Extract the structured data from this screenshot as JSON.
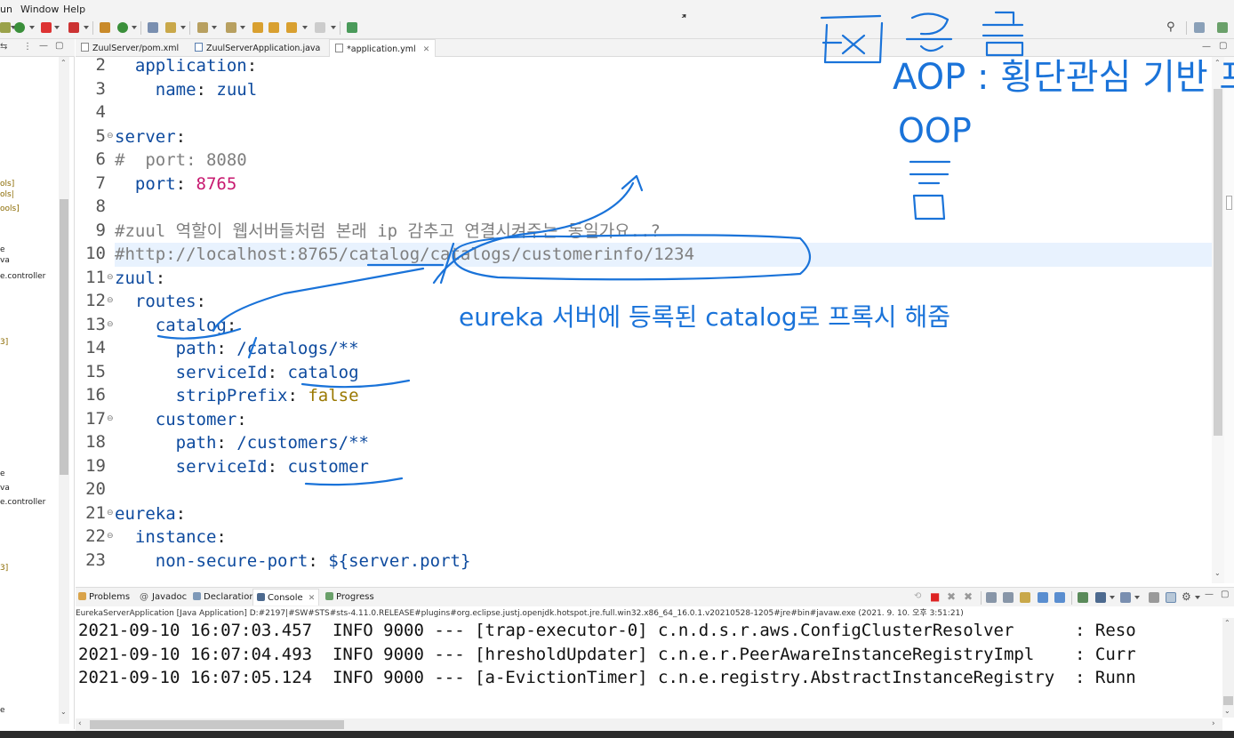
{
  "menu": [
    "un",
    "Window",
    "Help"
  ],
  "left_pane": {
    "fragments": [
      {
        "text": "ols]",
        "style": "brown"
      },
      {
        "text": "ols|",
        "style": "brown"
      },
      {
        "text": "ools]",
        "style": "brown"
      },
      {
        "text": "e",
        "style": ""
      },
      {
        "text": "va",
        "style": ""
      },
      {
        "text": "e.controller",
        "style": ""
      },
      {
        "text": "3]",
        "style": "brown"
      },
      {
        "text": "e",
        "style": ""
      },
      {
        "text": "va",
        "style": ""
      },
      {
        "text": "e.controller",
        "style": ""
      },
      {
        "text": "3]",
        "style": "brown"
      },
      {
        "text": "e",
        "style": ""
      }
    ]
  },
  "editor_tabs": [
    {
      "label": "ZuulServer/pom.xml"
    },
    {
      "label": "ZuulServerApplication.java"
    },
    {
      "label": "*application.yml"
    }
  ],
  "code_lines": [
    {
      "n": "2",
      "fold": false,
      "current": false,
      "tokens": [
        {
          "t": "  application",
          "c": "k"
        },
        {
          "t": ":",
          "c": "p"
        }
      ]
    },
    {
      "n": "3",
      "fold": false,
      "current": false,
      "tokens": [
        {
          "t": "    name",
          "c": "k"
        },
        {
          "t": ": ",
          "c": "p"
        },
        {
          "t": "zuul",
          "c": "v"
        }
      ]
    },
    {
      "n": "4",
      "fold": false,
      "current": false,
      "tokens": []
    },
    {
      "n": "5",
      "fold": true,
      "current": false,
      "tokens": [
        {
          "t": "server",
          "c": "k"
        },
        {
          "t": ":",
          "c": "p"
        }
      ]
    },
    {
      "n": "6",
      "fold": false,
      "current": false,
      "tokens": [
        {
          "t": "#  port: 8080",
          "c": "c"
        }
      ]
    },
    {
      "n": "7",
      "fold": false,
      "current": false,
      "tokens": [
        {
          "t": "  port",
          "c": "k"
        },
        {
          "t": ": ",
          "c": "p"
        },
        {
          "t": "8765",
          "c": "n"
        }
      ]
    },
    {
      "n": "8",
      "fold": false,
      "current": false,
      "tokens": []
    },
    {
      "n": "9",
      "fold": false,
      "current": false,
      "tokens": [
        {
          "t": "#zuul 역할이 웹서버들처럼 본래 ip 감추고 연결시켜주는 동일가요..?",
          "c": "c"
        }
      ]
    },
    {
      "n": "10",
      "fold": false,
      "current": true,
      "tokens": [
        {
          "t": "#http://localhost:8765/catalog/catalogs/customerinfo/1234",
          "c": "c"
        }
      ]
    },
    {
      "n": "11",
      "fold": true,
      "current": false,
      "tokens": [
        {
          "t": "zuul",
          "c": "k"
        },
        {
          "t": ":",
          "c": "p"
        }
      ]
    },
    {
      "n": "12",
      "fold": true,
      "current": false,
      "tokens": [
        {
          "t": "  routes",
          "c": "k"
        },
        {
          "t": ":",
          "c": "p"
        }
      ]
    },
    {
      "n": "13",
      "fold": true,
      "current": false,
      "tokens": [
        {
          "t": "    catalog",
          "c": "k"
        },
        {
          "t": ":",
          "c": "p"
        }
      ]
    },
    {
      "n": "14",
      "fold": false,
      "current": false,
      "tokens": [
        {
          "t": "      path",
          "c": "k"
        },
        {
          "t": ": ",
          "c": "p"
        },
        {
          "t": "/catalogs/**",
          "c": "v"
        }
      ]
    },
    {
      "n": "15",
      "fold": false,
      "current": false,
      "tokens": [
        {
          "t": "      serviceId",
          "c": "k"
        },
        {
          "t": ": ",
          "c": "p"
        },
        {
          "t": "catalog",
          "c": "v"
        }
      ]
    },
    {
      "n": "16",
      "fold": false,
      "current": false,
      "tokens": [
        {
          "t": "      stripPrefix",
          "c": "k"
        },
        {
          "t": ": ",
          "c": "p"
        },
        {
          "t": "false",
          "c": "b"
        }
      ]
    },
    {
      "n": "17",
      "fold": true,
      "current": false,
      "tokens": [
        {
          "t": "    customer",
          "c": "k"
        },
        {
          "t": ":",
          "c": "p"
        }
      ]
    },
    {
      "n": "18",
      "fold": false,
      "current": false,
      "tokens": [
        {
          "t": "      path",
          "c": "k"
        },
        {
          "t": ": ",
          "c": "p"
        },
        {
          "t": "/customers/**",
          "c": "v"
        }
      ]
    },
    {
      "n": "19",
      "fold": false,
      "current": false,
      "tokens": [
        {
          "t": "      serviceId",
          "c": "k"
        },
        {
          "t": ": ",
          "c": "p"
        },
        {
          "t": "customer",
          "c": "v"
        }
      ]
    },
    {
      "n": "20",
      "fold": false,
      "current": false,
      "tokens": []
    },
    {
      "n": "21",
      "fold": true,
      "current": false,
      "tokens": [
        {
          "t": "eureka",
          "c": "k"
        },
        {
          "t": ":",
          "c": "p"
        }
      ]
    },
    {
      "n": "22",
      "fold": true,
      "current": false,
      "tokens": [
        {
          "t": "  instance",
          "c": "k"
        },
        {
          "t": ":",
          "c": "p"
        }
      ]
    },
    {
      "n": "23",
      "fold": false,
      "current": false,
      "tokens": [
        {
          "t": "    non-secure-port",
          "c": "k"
        },
        {
          "t": ": ",
          "c": "p"
        },
        {
          "t": "${server.port}",
          "c": "v"
        }
      ]
    }
  ],
  "annotations": {
    "handwritten_lines": [
      "AOP : 횡단관심 기반 프로그램",
      "OOP",
      "eureka 서버에 등록된 catalog로 프록시 해줌"
    ]
  },
  "console_tabs": [
    {
      "label": "Problems",
      "active": false
    },
    {
      "label": "Javadoc",
      "active": false
    },
    {
      "label": "Declaration",
      "active": false
    },
    {
      "label": "Console",
      "active": true
    },
    {
      "label": "Progress",
      "active": false
    }
  ],
  "console": {
    "path": "EurekaServerApplication [Java Application] D:#2197|#SW#STS#sts-4.11.0.RELEASE#plugins#org.eclipse.justj.openjdk.hotspot.jre.full.win32.x86_64_16.0.1.v20210528-1205#jre#bin#javaw.exe  (2021. 9. 10. 오후 3:51:21)",
    "lines": [
      "2021-09-10 16:07:03.457  INFO 9000 --- [trap-executor-0] c.n.d.s.r.aws.ConfigClusterResolver      : Reso",
      "2021-09-10 16:07:04.493  INFO 9000 --- [hresholdUpdater] c.n.e.r.PeerAwareInstanceRegistryImpl    : Curr",
      "2021-09-10 16:07:05.124  INFO 9000 --- [a-EvictionTimer] c.n.e.registry.AbstractInstanceRegistry  : Runn"
    ]
  },
  "colors": {
    "key": "#0d4a9e",
    "number": "#c7186f",
    "boolean": "#9a7800",
    "comment": "#7f7f7f",
    "current_line": "#e8f2fe",
    "annotation_ink": "#1a73d9"
  }
}
